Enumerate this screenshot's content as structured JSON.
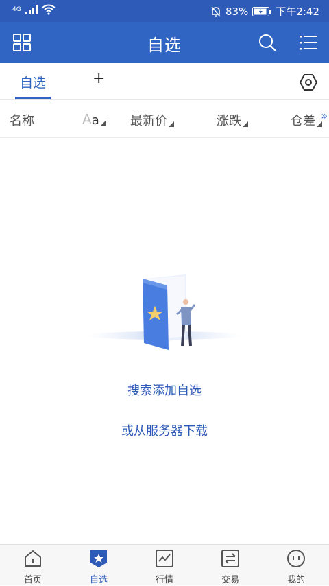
{
  "status_bar": {
    "network": "4G",
    "battery": "83%",
    "time": "下午2:42"
  },
  "app_bar": {
    "title": "自选"
  },
  "tabs": {
    "active": "自选",
    "add": "+"
  },
  "columns": {
    "name": "名称",
    "aa_big": "A",
    "aa_small": "a",
    "latest_price": "最新价",
    "change": "涨跌",
    "position_diff": "仓差",
    "more": "»"
  },
  "empty_state": {
    "search_add": "搜索添加自选",
    "download": "或从服务器下载"
  },
  "bottom_nav": [
    {
      "label": "首页",
      "icon": "home-icon"
    },
    {
      "label": "自选",
      "icon": "watchlist-icon"
    },
    {
      "label": "行情",
      "icon": "market-chart-icon"
    },
    {
      "label": "交易",
      "icon": "trade-exchange-icon"
    },
    {
      "label": "我的",
      "icon": "profile-icon"
    }
  ],
  "colors": {
    "primary": "#3165c3",
    "status_bar": "#2d5bb7",
    "link": "#2d5bb7"
  }
}
